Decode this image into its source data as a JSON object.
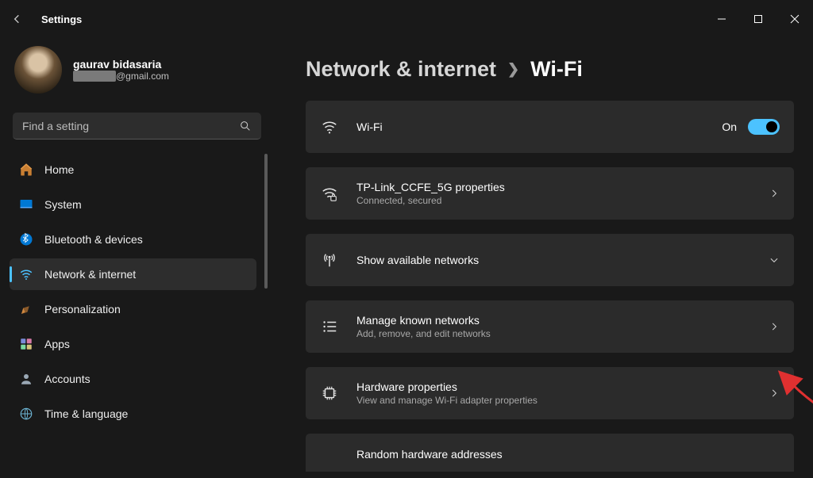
{
  "window": {
    "title": "Settings"
  },
  "profile": {
    "name": "gaurav bidasaria",
    "email_suffix": "@gmail.com"
  },
  "search": {
    "placeholder": "Find a setting"
  },
  "sidebar": {
    "items": [
      {
        "label": "Home"
      },
      {
        "label": "System"
      },
      {
        "label": "Bluetooth & devices"
      },
      {
        "label": "Network & internet"
      },
      {
        "label": "Personalization"
      },
      {
        "label": "Apps"
      },
      {
        "label": "Accounts"
      },
      {
        "label": "Time & language"
      }
    ]
  },
  "breadcrumb": {
    "parent": "Network & internet",
    "current": "Wi-Fi"
  },
  "wifi": {
    "title": "Wi-Fi",
    "toggle_label": "On"
  },
  "cards": {
    "network": {
      "title": "TP-Link_CCFE_5G properties",
      "sub": "Connected, secured"
    },
    "available": {
      "title": "Show available networks"
    },
    "manage": {
      "title": "Manage known networks",
      "sub": "Add, remove, and edit networks"
    },
    "hardware": {
      "title": "Hardware properties",
      "sub": "View and manage Wi-Fi adapter properties"
    },
    "random": {
      "title": "Random hardware addresses"
    }
  },
  "colors": {
    "accent": "#4cc2ff"
  }
}
